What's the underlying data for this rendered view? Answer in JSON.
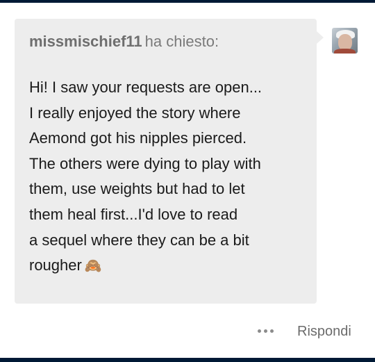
{
  "ask": {
    "asker_name": "missmischief11",
    "asker_suffix": "ha chiesto:",
    "lines": [
      "Hi! I saw your requests are open...",
      "I really enjoyed the story where",
      "Aemond got his nipples pierced.",
      "The others were dying to play with",
      "them, use weights but had to let",
      "them heal first...I'd love to read",
      "a sequel where they can be a bit",
      "rougher"
    ],
    "emoji": "🙈",
    "emoji_icon": "see-no-evil-monkey-icon"
  },
  "avatar": {
    "icon": "user-avatar"
  },
  "actions": {
    "more_icon": "more-options-icon",
    "reply_label": "Rispondi"
  },
  "colors": {
    "frame": "#001935",
    "bubble": "#ededed",
    "text": "#1a1a1a",
    "muted": "#6b6b6b"
  }
}
